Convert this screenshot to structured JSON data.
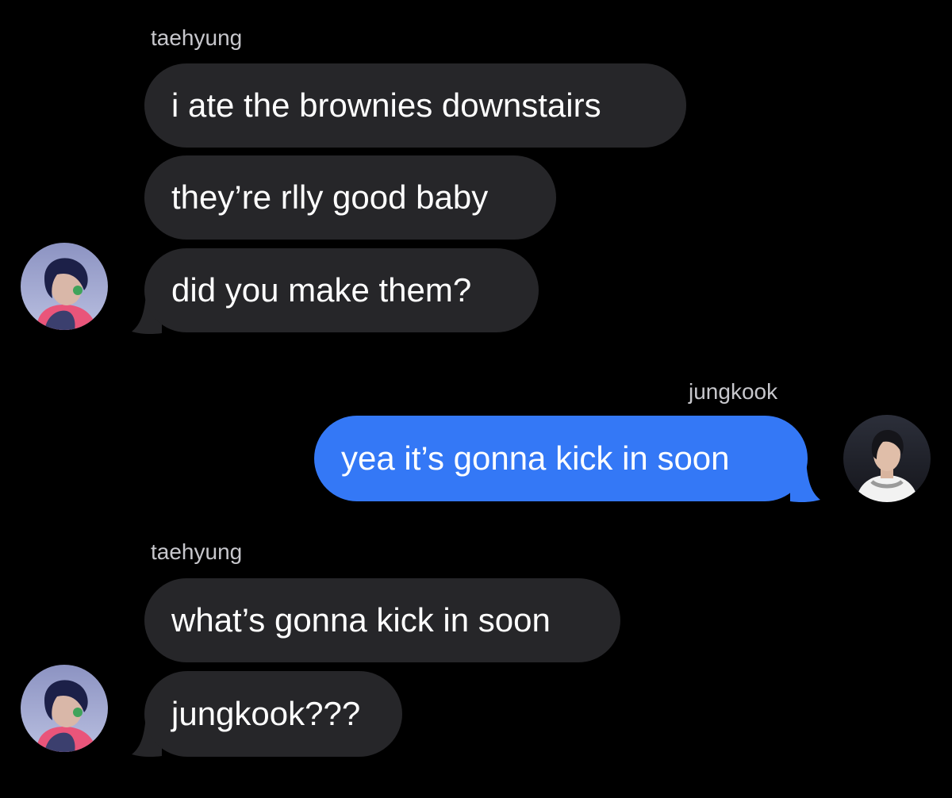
{
  "conversation": {
    "groups": [
      {
        "sender": "taehyung",
        "direction": "incoming",
        "avatar_icon": "taehyung-avatar",
        "messages": [
          "i ate the brownies downstairs",
          "they’re rlly good baby",
          "did you make them?"
        ]
      },
      {
        "sender": "jungkook",
        "direction": "outgoing",
        "avatar_icon": "jungkook-avatar",
        "messages": [
          "yea it’s gonna kick in soon"
        ]
      },
      {
        "sender": "taehyung",
        "direction": "incoming",
        "avatar_icon": "taehyung-avatar",
        "messages": [
          "what’s gonna kick in soon",
          "jungkook???"
        ]
      }
    ]
  },
  "colors": {
    "background": "#000000",
    "incoming_bubble": "#262629",
    "outgoing_bubble": "#3478f6",
    "sender_name": "#c7c7cc",
    "message_text": "#ffffff"
  }
}
